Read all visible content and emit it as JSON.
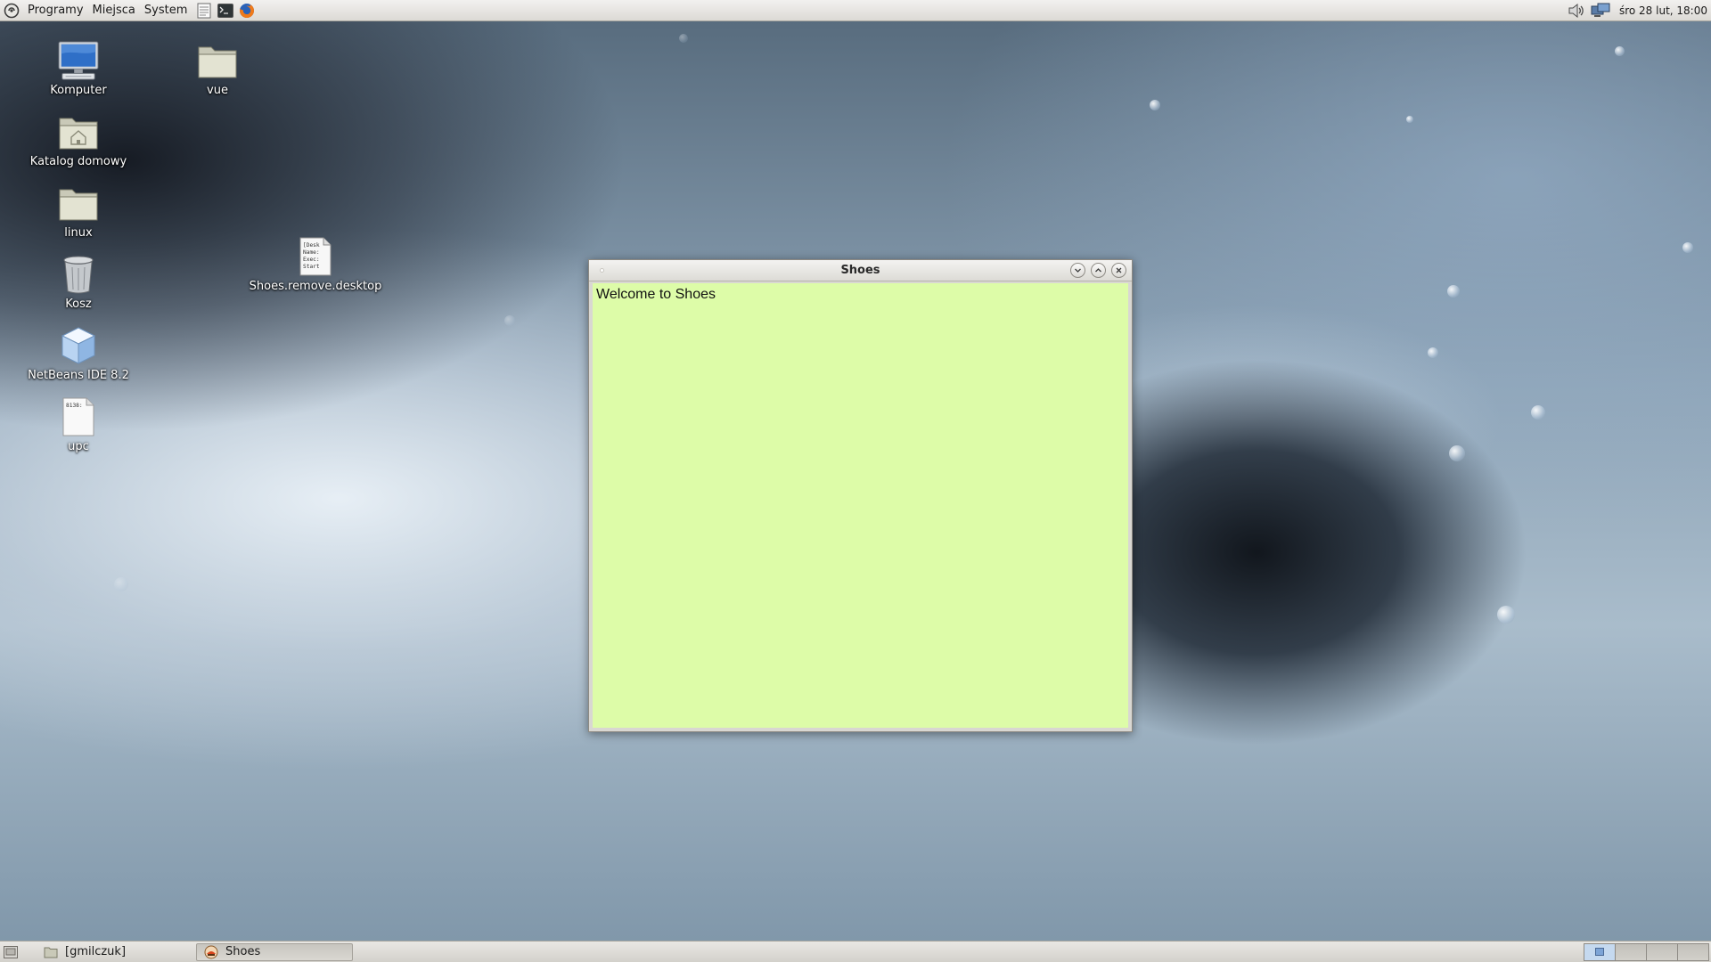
{
  "top_panel": {
    "menus": [
      "Programy",
      "Miejsca",
      "System"
    ],
    "launchers": [
      "text-editor-icon",
      "terminal-icon",
      "firefox-icon"
    ],
    "tray": [
      "volume-icon",
      "network-icon"
    ],
    "clock": "śro 28 lut, 18:00"
  },
  "desktop": {
    "icons": [
      {
        "label": "Komputer",
        "icon": "computer-icon"
      },
      {
        "label": "vue",
        "icon": "folder-icon"
      },
      {
        "label": "Katalog domowy",
        "icon": "home-folder-icon"
      },
      {
        "label": "linux",
        "icon": "folder-icon"
      },
      {
        "label": "Shoes.remove.desktop",
        "icon": "desktop-file-icon",
        "preview": [
          "[Desk",
          "Name:",
          "Exec:",
          "Start"
        ]
      },
      {
        "label": "Kosz",
        "icon": "trash-icon"
      },
      {
        "label": "NetBeans IDE 8.2",
        "icon": "netbeans-icon"
      },
      {
        "label": "upc",
        "icon": "text-file-icon",
        "preview": "8138:"
      }
    ]
  },
  "window": {
    "title": "Shoes",
    "content_text": "Welcome to Shoes",
    "background_color": "#ddfca8",
    "buttons": [
      "minimize-button",
      "maximize-button",
      "close-button"
    ]
  },
  "bottom_panel": {
    "tasks": [
      {
        "label": "[gmilczuk]",
        "icon": "folder-icon",
        "active": false
      },
      {
        "label": "Shoes",
        "icon": "shoes-icon",
        "active": true
      }
    ],
    "workspaces": 4,
    "current_workspace": 1
  }
}
